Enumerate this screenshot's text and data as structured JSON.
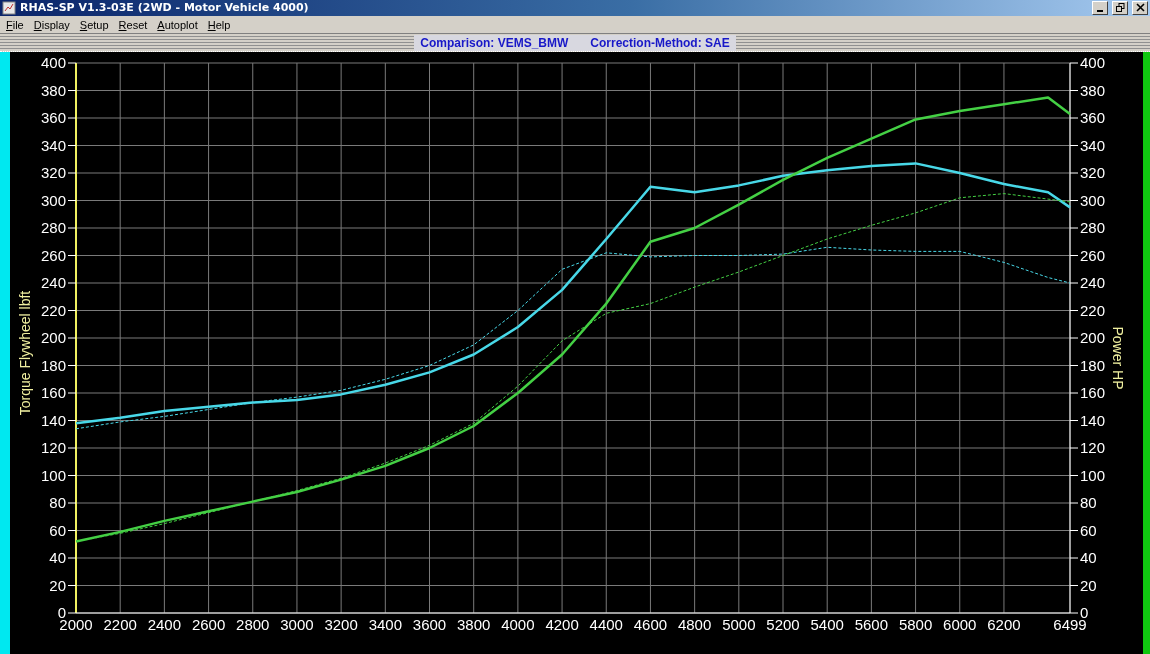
{
  "window": {
    "title": "RHAS-SP V1.3-03E  (2WD - Motor Vehicle 4000)"
  },
  "menu": [
    {
      "label": "File"
    },
    {
      "label": "Display"
    },
    {
      "label": "Setup"
    },
    {
      "label": "Reset"
    },
    {
      "label": "Autoplot"
    },
    {
      "label": "Help"
    }
  ],
  "header": {
    "comparison": "Comparison: VEMS_BMW",
    "correction": "Correction-Method: SAE"
  },
  "chart": {
    "chart_data": {
      "type": "line",
      "ylabel": "Torque Flywheel lbft",
      "y2label": "Power HP",
      "x": [
        2000,
        2200,
        2400,
        2600,
        2800,
        3000,
        3200,
        3400,
        3600,
        3800,
        4000,
        4200,
        4400,
        4600,
        4800,
        5000,
        5200,
        5400,
        5600,
        5800,
        6000,
        6200,
        6400,
        6499
      ],
      "series": [
        {
          "color": "#48d8e8",
          "line_style": "solid",
          "values": [
            138,
            142,
            147,
            150,
            153,
            155,
            159,
            166,
            175,
            188,
            208,
            235,
            272,
            310,
            306,
            311,
            318,
            322,
            325,
            327,
            320,
            312,
            306,
            295
          ]
        },
        {
          "color": "#48d8e8",
          "line_style": "dashed",
          "values": [
            134,
            139,
            143,
            148,
            153,
            157,
            162,
            170,
            180,
            195,
            220,
            250,
            262,
            259,
            260,
            260,
            261,
            266,
            264,
            263,
            263,
            255,
            244,
            240
          ]
        },
        {
          "color": "#44d044",
          "line_style": "solid",
          "values": [
            52,
            59,
            67,
            74,
            81,
            88,
            97,
            107,
            120,
            136,
            160,
            188,
            225,
            270,
            280,
            297,
            315,
            331,
            345,
            359,
            365,
            370,
            375,
            363
          ]
        },
        {
          "color": "#44d044",
          "line_style": "dashed",
          "values": [
            52,
            58,
            65,
            73,
            81,
            89,
            98,
            109,
            122,
            138,
            165,
            198,
            218,
            225,
            237,
            248,
            260,
            272,
            282,
            291,
            302,
            305,
            301,
            299
          ]
        }
      ],
      "xlim": [
        2000,
        6499
      ],
      "ylim": [
        0,
        400
      ],
      "y2lim": [
        0,
        400
      ],
      "grid": true,
      "xticks": [
        2000,
        2200,
        2400,
        2600,
        2800,
        3000,
        3200,
        3400,
        3600,
        3800,
        4000,
        4200,
        4400,
        4600,
        4800,
        5000,
        5200,
        5400,
        5600,
        5800,
        6000,
        6200,
        6499
      ],
      "yticks": [
        0,
        20,
        40,
        60,
        80,
        100,
        120,
        140,
        160,
        180,
        200,
        220,
        240,
        260,
        280,
        300,
        320,
        340,
        360,
        380,
        400
      ],
      "y2ticks": [
        0,
        20,
        40,
        60,
        80,
        100,
        120,
        140,
        160,
        180,
        200,
        220,
        240,
        260,
        280,
        300,
        320,
        340,
        360,
        380,
        400
      ]
    }
  }
}
